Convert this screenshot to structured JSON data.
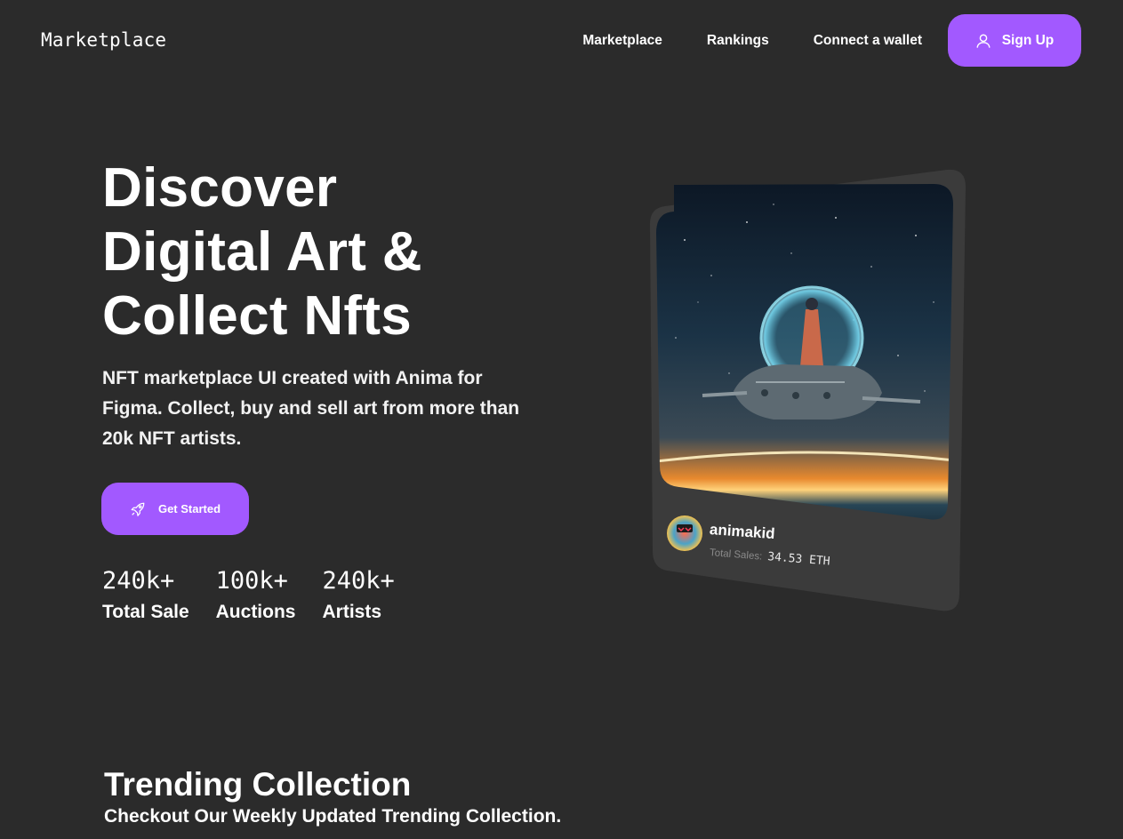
{
  "header": {
    "logo": "Marketplace",
    "nav": [
      "Marketplace",
      "Rankings",
      "Connect a wallet"
    ],
    "signup_label": "Sign Up",
    "signup_icon": "user-icon"
  },
  "hero": {
    "title_lines": [
      "Discover",
      "Digital Art &",
      "Collect Nfts"
    ],
    "description": "NFT marketplace UI created with Anima for Figma. Collect, buy and sell art from more than 20k NFT artists.",
    "cta_label": "Get Started",
    "cta_icon": "rocket-icon",
    "stats": [
      {
        "value": "240k+",
        "label": "Total Sale"
      },
      {
        "value": "100k+",
        "label": "Auctions"
      },
      {
        "value": "240k+",
        "label": "Artists"
      }
    ]
  },
  "featured": {
    "creator": "animakid",
    "sales_label": "Total Sales:",
    "sales_value": "34.53 ETH"
  },
  "trending": {
    "title": "Trending Collection",
    "subtitle": "Checkout Our Weekly Updated Trending Collection."
  },
  "colors": {
    "background": "#2b2b2b",
    "accent": "#a259ff",
    "card": "#3b3b3b"
  }
}
